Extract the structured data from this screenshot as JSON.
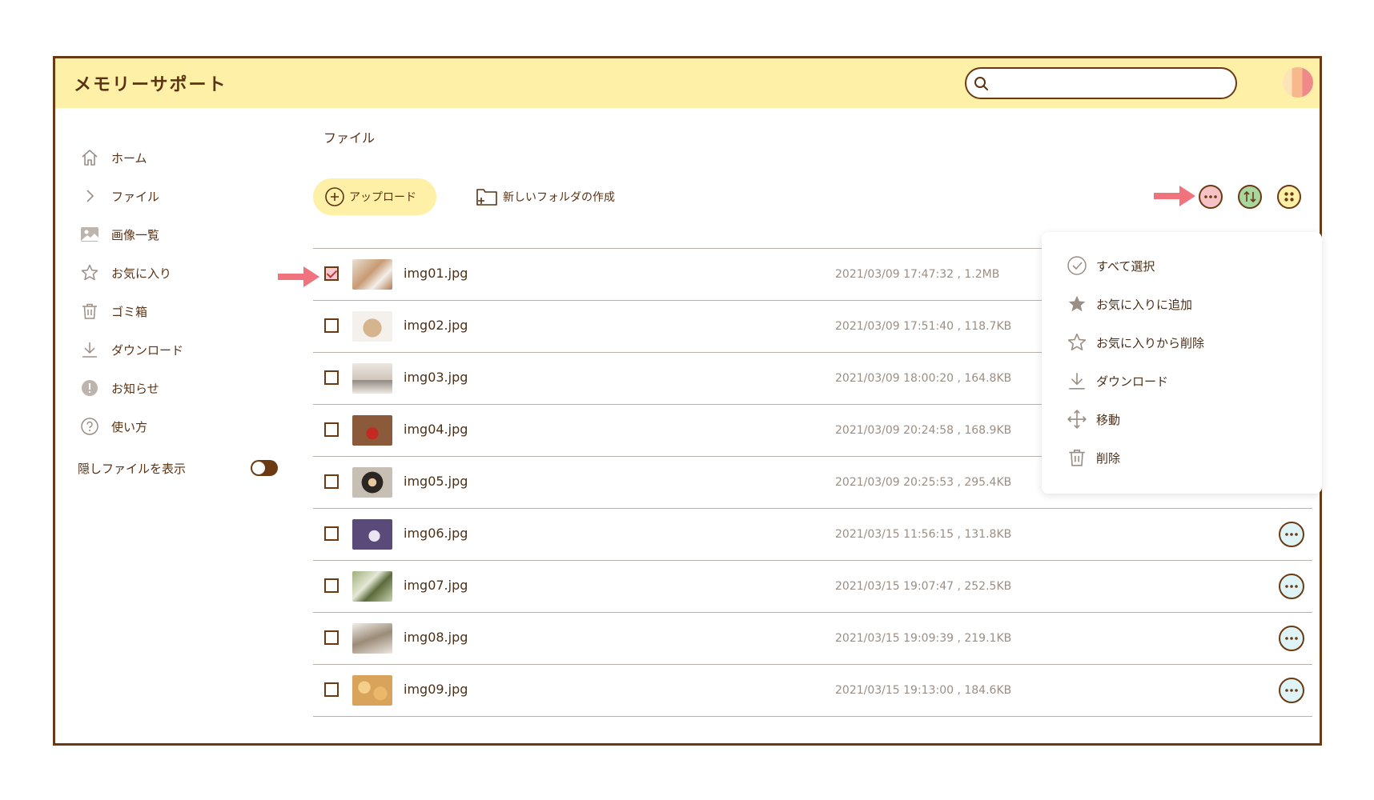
{
  "app": {
    "title": "メモリーサポート"
  },
  "search": {
    "placeholder": ""
  },
  "sidebar": {
    "items": [
      {
        "label": "ホーム",
        "icon": "home-icon"
      },
      {
        "label": "ファイル",
        "icon": "chevron-right-icon"
      },
      {
        "label": "画像一覧",
        "icon": "image-icon"
      },
      {
        "label": "お気に入り",
        "icon": "star-icon"
      },
      {
        "label": "ゴミ箱",
        "icon": "trash-icon"
      },
      {
        "label": "ダウンロード",
        "icon": "download-icon"
      },
      {
        "label": "お知らせ",
        "icon": "info-icon"
      },
      {
        "label": "使い方",
        "icon": "help-icon"
      }
    ],
    "hidden_files_label": "隠しファイルを表示",
    "hidden_files_on": true
  },
  "breadcrumb": "ファイル",
  "toolbar": {
    "upload_label": "アップロード",
    "new_folder_label": "新しいフォルダの作成"
  },
  "files": [
    {
      "name": "img01.jpg",
      "meta": "2021/03/09 17:47:32 , 1.2MB",
      "checked": true
    },
    {
      "name": "img02.jpg",
      "meta": "2021/03/09 17:51:40 , 118.7KB",
      "checked": false
    },
    {
      "name": "img03.jpg",
      "meta": "2021/03/09 18:00:20 , 164.8KB",
      "checked": false
    },
    {
      "name": "img04.jpg",
      "meta": "2021/03/09 20:24:58 , 168.9KB",
      "checked": false
    },
    {
      "name": "img05.jpg",
      "meta": "2021/03/09 20:25:53 , 295.4KB",
      "checked": false
    },
    {
      "name": "img06.jpg",
      "meta": "2021/03/15 11:56:15 , 131.8KB",
      "checked": false
    },
    {
      "name": "img07.jpg",
      "meta": "2021/03/15 19:07:47 , 252.5KB",
      "checked": false
    },
    {
      "name": "img08.jpg",
      "meta": "2021/03/15 19:09:39 , 219.1KB",
      "checked": false
    },
    {
      "name": "img09.jpg",
      "meta": "2021/03/15 19:13:00 , 184.6KB",
      "checked": false
    }
  ],
  "menu": {
    "items": [
      {
        "label": "すべて選択",
        "icon": "check-circle-icon"
      },
      {
        "label": "お気に入りに追加",
        "icon": "star-filled-icon"
      },
      {
        "label": "お気に入りから削除",
        "icon": "star-outline-icon"
      },
      {
        "label": "ダウンロード",
        "icon": "download-icon"
      },
      {
        "label": "移動",
        "icon": "move-icon"
      },
      {
        "label": "削除",
        "icon": "trash-icon"
      }
    ]
  },
  "colors": {
    "header_bg": "#fff0a8",
    "brand_brown": "#6b3a12",
    "more_pink": "#f7c2c5",
    "sort_green": "#a8d8a0",
    "grid_yellow": "#fff0a8",
    "arrow_pink": "#f0737e"
  }
}
